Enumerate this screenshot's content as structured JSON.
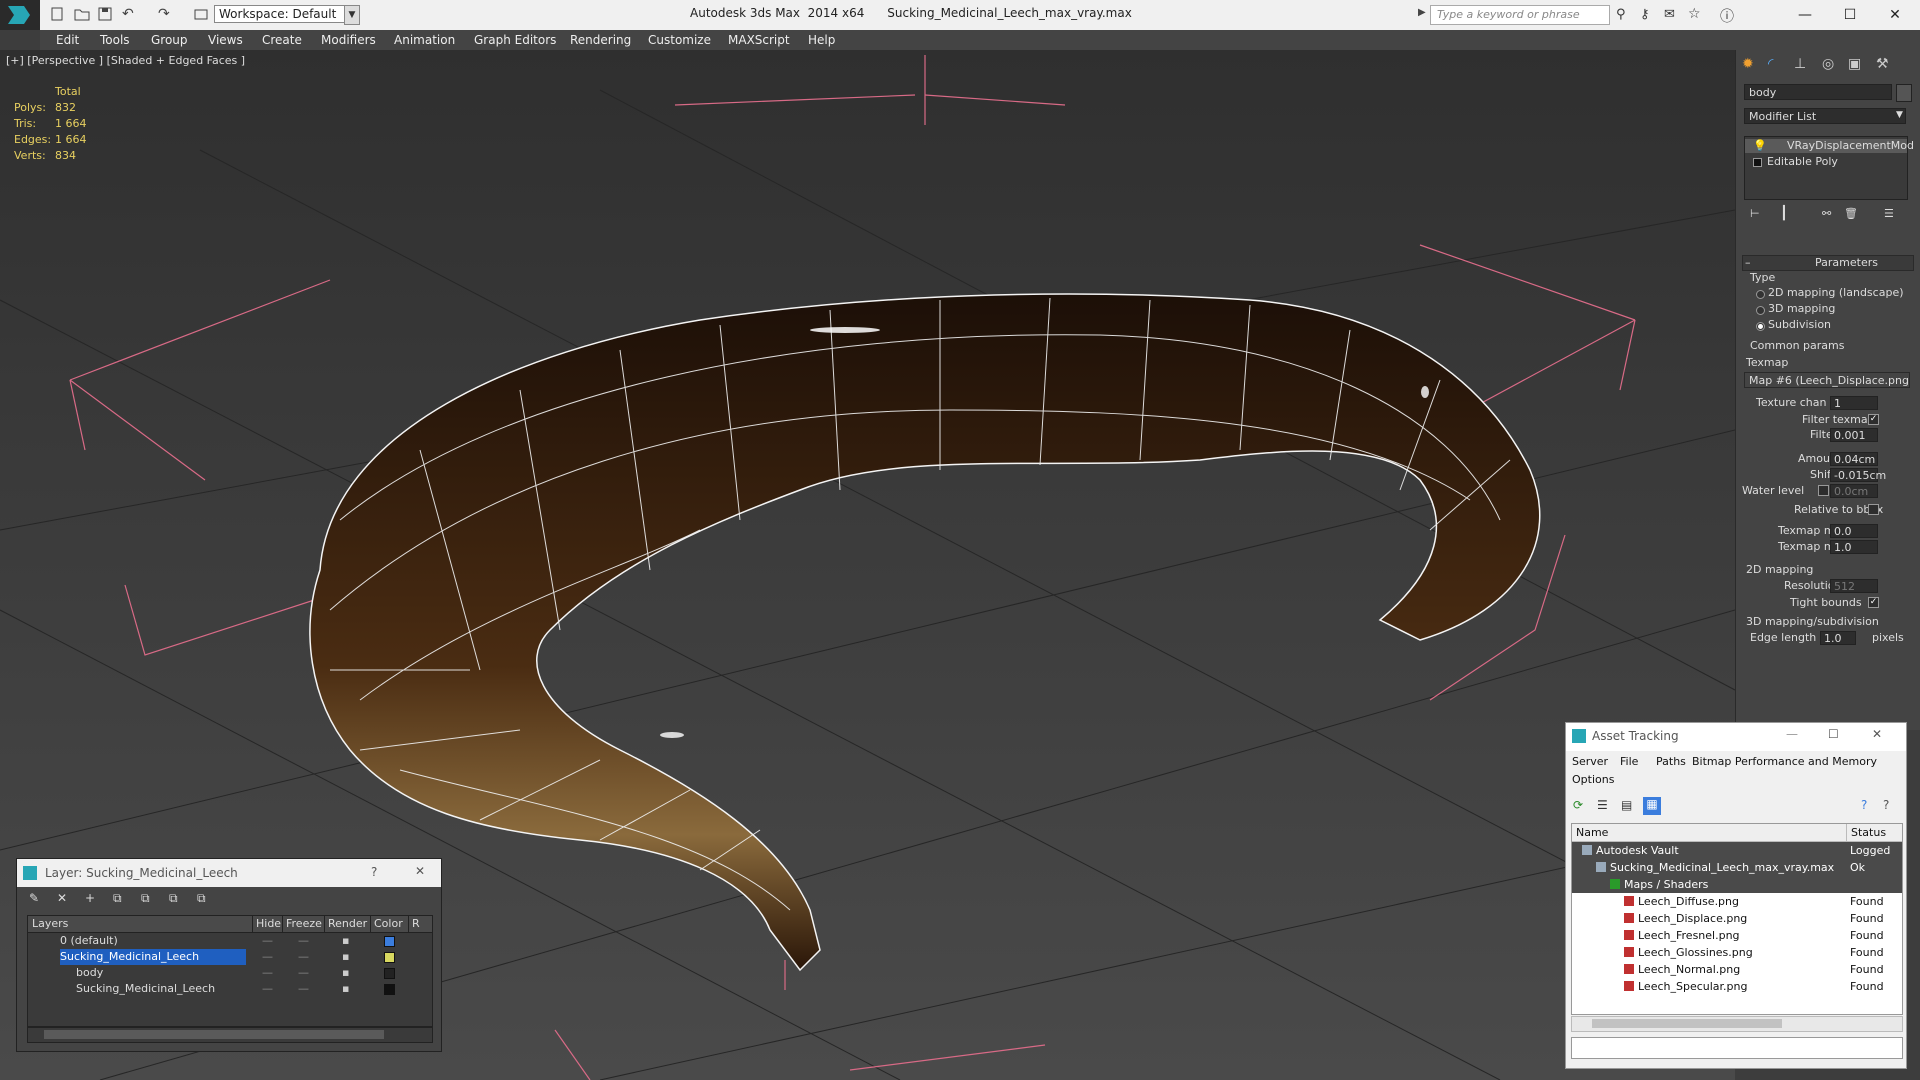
{
  "titlebar": {
    "workspace": "Workspace: Default",
    "app_title": "Autodesk 3ds Max  2014 x64      Sucking_Medicinal_Leech_max_vray.max",
    "search_placeholder": "Type a keyword or phrase"
  },
  "menu": [
    "Edit",
    "Tools",
    "Group",
    "Views",
    "Create",
    "Modifiers",
    "Animation",
    "Graph Editors",
    "Rendering",
    "Customize",
    "MAXScript",
    "Help"
  ],
  "viewport": {
    "label": "[+] [Perspective ] [Shaded + Edged Faces ]",
    "stats_header": "Total",
    "stats": [
      {
        "k": "Polys:",
        "v": "832"
      },
      {
        "k": "Tris:",
        "v": "1 664"
      },
      {
        "k": "Edges:",
        "v": "1 664"
      },
      {
        "k": "Verts:",
        "v": "834"
      }
    ]
  },
  "command_panel": {
    "object_name": "body",
    "modifier_list": "Modifier List",
    "stack": [
      "VRayDisplacementMod",
      "Editable Poly"
    ],
    "parameters_title": "Parameters",
    "type_label": "Type",
    "types": [
      {
        "label": "2D mapping (landscape)",
        "on": false
      },
      {
        "label": "3D mapping",
        "on": false
      },
      {
        "label": "Subdivision",
        "on": true
      }
    ],
    "common_params": "Common params",
    "texmap_label": "Texmap",
    "texmap_value": "Map #6 (Leech_Displace.png)",
    "texture_chan_label": "Texture chan",
    "texture_chan": "1",
    "filter_texmap_label": "Filter texmap",
    "filter_blur_label": "Filter blur",
    "filter_blur": "0.001",
    "amount_label": "Amount",
    "amount": "0.04cm",
    "shift_label": "Shift",
    "shift": "-0.015cm",
    "water_level_label": "Water level",
    "water_level": "0.0cm",
    "relative_bbox_label": "Relative to bbox",
    "texmap_min_label": "Texmap min",
    "texmap_min": "0.0",
    "texmap_max_label": "Texmap max",
    "texmap_max": "1.0",
    "mapping_2d": "2D mapping",
    "resolution_label": "Resolution",
    "resolution": "512",
    "tight_bounds_label": "Tight bounds",
    "mapping_3d": "3D mapping/subdivision",
    "edge_length_label": "Edge length",
    "edge_length": "1.0",
    "pixels": "pixels"
  },
  "asset_tracking": {
    "title": "Asset Tracking",
    "menus": [
      "Server",
      "File",
      "Paths",
      "Bitmap Performance and Memory"
    ],
    "menu2": "Options",
    "col_name": "Name",
    "col_status": "Status",
    "rows": [
      {
        "name": "Autodesk Vault",
        "status": "Logged O",
        "indent": 0
      },
      {
        "name": "Sucking_Medicinal_Leech_max_vray.max",
        "status": "Ok",
        "indent": 1
      },
      {
        "name": "Maps / Shaders",
        "status": "",
        "indent": 2
      },
      {
        "name": "Leech_Diffuse.png",
        "status": "Found",
        "indent": 3
      },
      {
        "name": "Leech_Displace.png",
        "status": "Found",
        "indent": 3
      },
      {
        "name": "Leech_Fresnel.png",
        "status": "Found",
        "indent": 3
      },
      {
        "name": "Leech_Glossines.png",
        "status": "Found",
        "indent": 3
      },
      {
        "name": "Leech_Normal.png",
        "status": "Found",
        "indent": 3
      },
      {
        "name": "Leech_Specular.png",
        "status": "Found",
        "indent": 3
      }
    ]
  },
  "layer_dialog": {
    "title": "Layer: Sucking_Medicinal_Leech",
    "help": "?",
    "columns": [
      "Layers",
      "Hide",
      "Freeze",
      "Render",
      "Color",
      "R"
    ],
    "rows": [
      {
        "name": "0 (default)",
        "color": "#3b7ddd"
      },
      {
        "name": "Sucking_Medicinal_Leech",
        "color": "#d8d860"
      },
      {
        "name": "body",
        "color": "#222222"
      },
      {
        "name": "Sucking_Medicinal_Leech",
        "color": "#111111"
      }
    ]
  }
}
